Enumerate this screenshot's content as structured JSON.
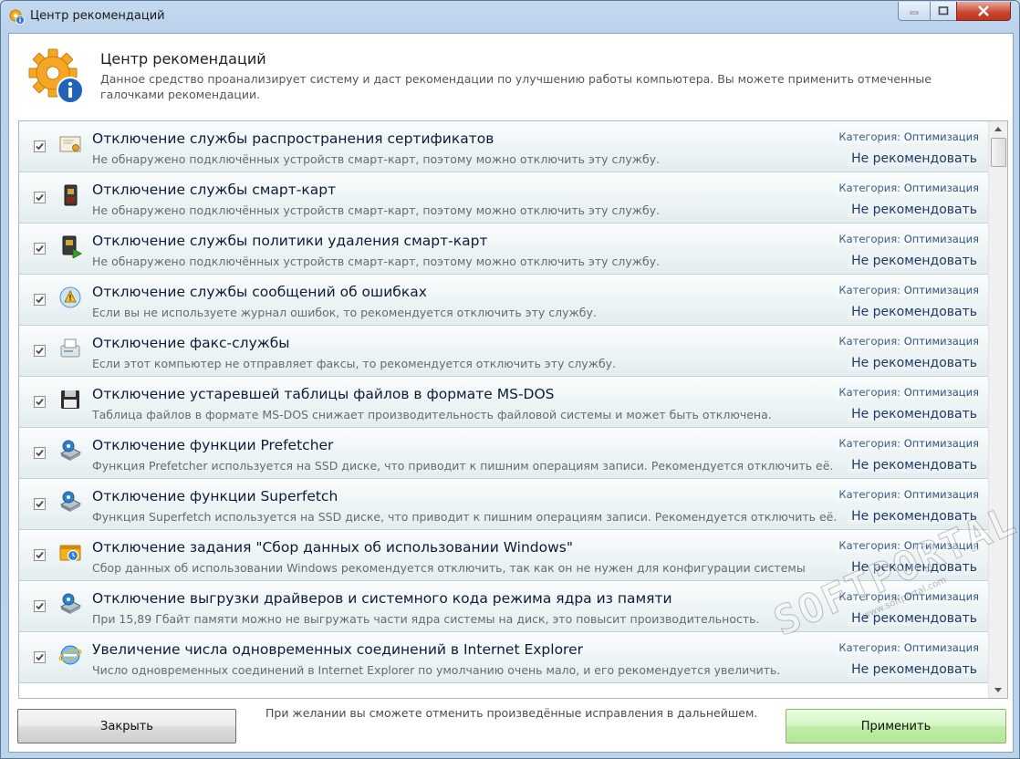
{
  "window": {
    "title": "Центр рекомендаций"
  },
  "header": {
    "title": "Центр рекомендаций",
    "description": "Данное средство проанализирует систему и даст рекомендации по улучшению работы компьютера. Вы можете применить отмеченные галочками рекомендации."
  },
  "category_prefix": "Категория:",
  "items": [
    {
      "checked": true,
      "icon": "certificate-icon",
      "title": "Отключение службы распространения сертификатов",
      "description": "Не обнаружено подключённых устройств смарт-карт, поэтому можно отключить эту службу.",
      "category": "Оптимизация",
      "action": "Не рекомендовать"
    },
    {
      "checked": true,
      "icon": "smart-card-icon",
      "title": "Отключение службы смарт-карт",
      "description": "Не обнаружено подключённых устройств смарт-карт, поэтому можно отключить эту службу.",
      "category": "Оптимизация",
      "action": "Не рекомендовать"
    },
    {
      "checked": true,
      "icon": "smart-card-removal-icon",
      "title": "Отключение службы политики удаления смарт-карт",
      "description": "Не обнаружено подключённых устройств смарт-карт, поэтому можно отключить эту службу.",
      "category": "Оптимизация",
      "action": "Не рекомендовать"
    },
    {
      "checked": true,
      "icon": "error-report-icon",
      "title": "Отключение службы сообщений об ошибках",
      "description": "Если вы не используете журнал ошибок, то рекомендуется отключить эту службу.",
      "category": "Оптимизация",
      "action": "Не рекомендовать"
    },
    {
      "checked": true,
      "icon": "fax-icon",
      "title": "Отключение факс-службы",
      "description": "Если этот компьютер не отправляет факсы, то рекомендуется отключить эту службу.",
      "category": "Оптимизация",
      "action": "Не рекомендовать"
    },
    {
      "checked": true,
      "icon": "floppy-disk-icon",
      "title": "Отключение устаревшей таблицы файлов в формате MS-DOS",
      "description": "Таблица файлов в формате MS-DOS снижает производительность файловой системы и может быть отключена.",
      "category": "Оптимизация",
      "action": "Не рекомендовать"
    },
    {
      "checked": true,
      "icon": "disk-settings-icon",
      "title": "Отключение функции Prefetcher",
      "description": "Функция Prefetcher используется на SSD диске, что приводит к пишним операциям записи. Рекомендуется отключить её.",
      "category": "Оптимизация",
      "action": "Не рекомендовать"
    },
    {
      "checked": true,
      "icon": "disk-settings-icon",
      "title": "Отключение функции Superfetch",
      "description": "Функция Superfetch используется на SSD диске, что приводит к пишним операциям записи. Рекомендуется отключить её.",
      "category": "Оптимизация",
      "action": "Не рекомендовать"
    },
    {
      "checked": true,
      "icon": "scheduled-task-icon",
      "title": "Отключение задания \"Сбор данных об использовании Windows\"",
      "description": "Сбор данных об использовании Windows рекомендуется отключить, так как он не нужен для конфигурации системы",
      "category": "Оптимизация",
      "action": "Не рекомендовать"
    },
    {
      "checked": true,
      "icon": "disk-settings-icon",
      "title": "Отключение выгрузки драйверов и системного кода режима ядра из памяти",
      "description": "При 15,89 Гбайт памяти можно не выгружать части ядра системы на диск, это повысит производительность.",
      "category": "Оптимизация",
      "action": "Не рекомендовать"
    },
    {
      "checked": true,
      "icon": "internet-explorer-icon",
      "title": "Увеличение числа одновременных соединений в Internet Explorer",
      "description": "Число одновременных соединений в Internet Explorer по умолчанию очень мало, и его рекомендуется увеличить.",
      "category": "Оптимизация",
      "action": "Не рекомендовать"
    }
  ],
  "footer": {
    "close_label": "Закрыть",
    "apply_label": "Применить",
    "note": "При желании вы сможете отменить произведённые исправления в дальнейшем."
  },
  "watermark": {
    "big": "SOFTPORTAL",
    "small": "www.softportal.com"
  }
}
